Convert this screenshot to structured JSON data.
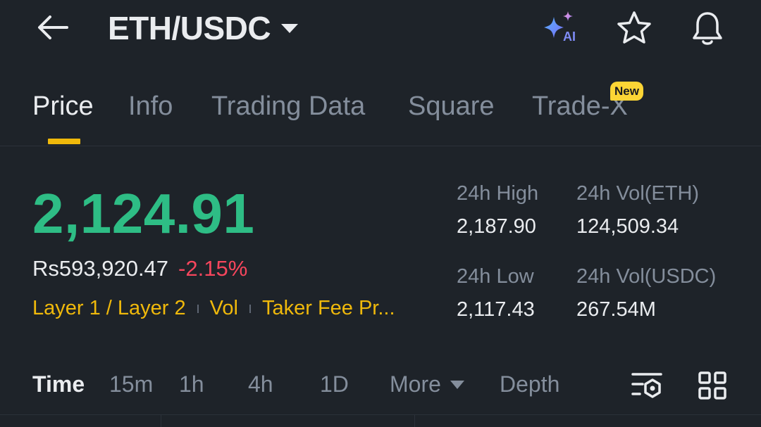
{
  "header": {
    "pair": "ETH/USDC",
    "ai_label": "AI"
  },
  "tabs": [
    {
      "label": "Price",
      "active": true
    },
    {
      "label": "Info"
    },
    {
      "label": "Trading Data"
    },
    {
      "label": "Square"
    },
    {
      "label": "Trade-X",
      "badge": "New"
    }
  ],
  "price": {
    "last": "2,124.91",
    "fiat": "Rs593,920.47",
    "change": "-2.15%",
    "tags": [
      "Layer 1 / Layer 2",
      "Vol",
      "Taker Fee Pr..."
    ]
  },
  "stats": {
    "high_label": "24h High",
    "high_value": "2,187.90",
    "vol_base_label": "24h Vol(ETH)",
    "vol_base_value": "124,509.34",
    "low_label": "24h Low",
    "low_value": "2,117.43",
    "vol_quote_label": "24h Vol(USDC)",
    "vol_quote_value": "267.54M"
  },
  "intervals": {
    "items": [
      "Time",
      "15m",
      "1h",
      "4h",
      "1D"
    ],
    "more": "More",
    "depth": "Depth"
  },
  "colors": {
    "background": "#1e2329",
    "up": "#2ebd85",
    "down": "#f6465d",
    "accent": "#f0b90b",
    "muted": "#848e9c"
  }
}
